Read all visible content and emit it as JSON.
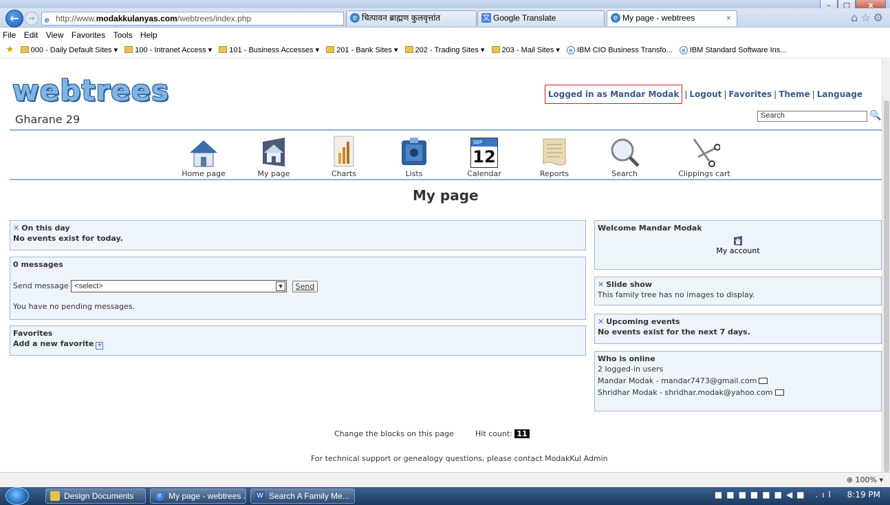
{
  "browser": {
    "address": {
      "prefix": "http://www.",
      "domain": "modakkulanyas.com",
      "path": "/webtrees/index.php"
    },
    "addr_tools": "⌕ ▾ ↻",
    "tabs": [
      {
        "label": "चित्पावन ब्राह्मण कुलवृत्तांत"
      },
      {
        "label": "Google Translate"
      },
      {
        "label": "My page - webtrees",
        "close": "×"
      }
    ],
    "right_controls": "⌂☆⚙",
    "window_buttons": [
      "–",
      "□",
      "x"
    ],
    "menu": [
      "File",
      "Edit",
      "View",
      "Favorites",
      "Tools",
      "Help"
    ],
    "favorites": [
      "000 - Daily Default Sites ▾",
      "100 - Intranet Access ▾",
      "101 - Business Accesses ▾",
      "201 - Bank Sites ▾",
      "202 - Trading Sites ▾",
      "203 - Mail Sites ▾",
      "IBM CIO Business Transfo...",
      "IBM Standard Software Ins..."
    ],
    "zoom": "⊕ 100% ▾"
  },
  "header": {
    "logo": "webtrees",
    "site_name": "Gharane 29",
    "logged_in": "Logged in as Mandar Modak",
    "links": [
      "Logout",
      "Favorites",
      "Theme",
      "Language"
    ],
    "search_placeholder": "Search"
  },
  "nav": [
    {
      "label": "Home page",
      "icon": "home-icon"
    },
    {
      "label": "My page",
      "icon": "my-page-icon"
    },
    {
      "label": "Charts",
      "icon": "charts-icon"
    },
    {
      "label": "Lists",
      "icon": "lists-icon"
    },
    {
      "label": "Calendar",
      "icon": "calendar-icon",
      "day": "12",
      "month": "SEP"
    },
    {
      "label": "Reports",
      "icon": "reports-icon"
    },
    {
      "label": "Search",
      "icon": "search-icon"
    },
    {
      "label": "Clippings cart",
      "icon": "scissors-icon"
    }
  ],
  "page_title": "My page",
  "left": {
    "on_this_day": {
      "title": "On this day",
      "text": "No events exist for today."
    },
    "messages": {
      "title": "0 messages",
      "send_label": "Send message",
      "select_value": "<select>",
      "send_button": "Send",
      "pending": "You have no pending messages."
    },
    "favorites": {
      "title": "Favorites",
      "add": "Add a new favorite"
    }
  },
  "right": {
    "welcome": {
      "title": "Welcome Mandar Modak",
      "my_account": "My account"
    },
    "slideshow": {
      "title": "Slide show",
      "text": "This family tree has no images to display."
    },
    "upcoming": {
      "title": "Upcoming events",
      "text": "No events exist for the next 7 days."
    },
    "online": {
      "title": "Who is online",
      "count": "2 logged-in users",
      "users": [
        "Mandar Modak - mandar7473@gmail.com",
        "Shridhar Modak - shridhar.modak@yahoo.com"
      ]
    }
  },
  "footer": {
    "change_blocks": "Change the blocks on this page",
    "hit_label": "Hit count:",
    "hit_count": "11",
    "support": "For technical support or genealogy questions, please contact ModakKul Admin"
  },
  "taskbar": {
    "tasks": [
      "Design Documents",
      "My page - webtrees ...",
      "Search A Family Me..."
    ],
    "time": "8:19 PM",
    "tray_icons": "■■■■■■◀■ .ıl"
  }
}
